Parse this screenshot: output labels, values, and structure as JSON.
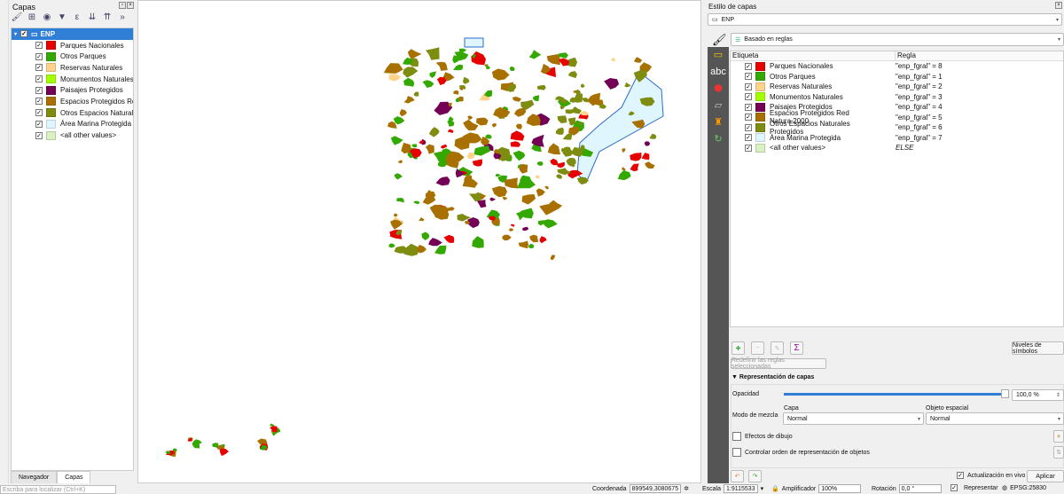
{
  "layers_panel": {
    "title": "Capas",
    "layer": "ENP",
    "items": [
      {
        "label": "Parques Nacionales",
        "color": "#e60000"
      },
      {
        "label": "Otros Parques",
        "color": "#33a800"
      },
      {
        "label": "Reservas Naturales",
        "color": "#ffd38a"
      },
      {
        "label": "Monumentos Naturales",
        "color": "#a3ff00"
      },
      {
        "label": "Paisajes Protegidos",
        "color": "#730055"
      },
      {
        "label": "Espacios Protegidos Red Natura 2000",
        "color": "#a87000"
      },
      {
        "label": "Otros Espacios Naturales Protegidos",
        "color": "#7e8c10"
      },
      {
        "label": "Área Marina Protegida",
        "color": "#e0f6ff"
      },
      {
        "label": "<all other values>",
        "color": "#d9f0c0"
      }
    ],
    "tabs": [
      "Navegador",
      "Capas"
    ]
  },
  "style_panel": {
    "title": "Estilo de capas",
    "layer": "ENP",
    "renderer": "Basado en reglas",
    "col_label": "Etiqueta",
    "col_rule": "Regla",
    "rules": [
      "\"enp_fgral\" = 8",
      "\"enp_fgral\" = 1",
      "\"enp_fgral\" = 2",
      "\"enp_fgral\" = 3",
      "\"enp_fgral\" = 4",
      "\"enp_fgral\" = 5",
      "\"enp_fgral\" = 6",
      "\"enp_fgral\" = 7",
      "ELSE"
    ],
    "symbol_levels": "Niveles de símbolos",
    "refine": "Redefinir las reglas seleccionadas",
    "rendering_section": "Representación de capas",
    "opacity_label": "Opacidad",
    "opacity_value": "100,0 %",
    "opacity": 1.0,
    "blend_label": "Modo de mezcla",
    "blend_layer_label": "Capa",
    "blend_layer": "Normal",
    "blend_feature_label": "Objeto espacial",
    "blend_feature": "Normal",
    "effects": "Efectos de dibujo",
    "order": "Controlar orden de representación de objetos",
    "live_update": "Actualización en vivo",
    "apply": "Aplicar"
  },
  "status": {
    "search_placeholder": "Escriba para localizar (Ctrl+K)",
    "coord_label": "Coordenada",
    "coord": "899549,3080675",
    "scale_label": "Escala",
    "scale": "1:9115533",
    "magnifier_label": "Amplificador",
    "magnifier": "100%",
    "rotation_label": "Rotación",
    "rotation": "0,0 °",
    "render": "Representar",
    "crs": "EPSG:25830"
  }
}
